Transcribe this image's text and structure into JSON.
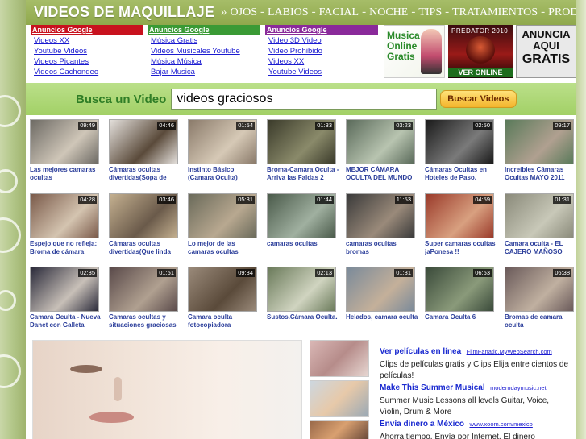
{
  "header": {
    "title": "VIDEOS DE MAQUILLAJE",
    "sep": "»",
    "nav": [
      "OJOS",
      "LABIOS",
      "FACIAL",
      "NOCHE",
      "TIPS",
      "TRATAMIENTOS",
      "PRODUCTOS"
    ]
  },
  "ads": [
    {
      "heading": "Anuncios Google",
      "links": [
        "Videos XX",
        "Youtube Videos",
        "Videos Picantes",
        "Videos Cachondeo"
      ]
    },
    {
      "heading": "Anuncios Google",
      "links": [
        "Música Gratis",
        "Videos Musicales Youtube",
        "Música Música",
        "Bajar Musica"
      ]
    },
    {
      "heading": "Anuncios Google",
      "links": [
        "Video 3D Video",
        "Video Prohibido",
        "Videos XX",
        "Youtube Videos"
      ]
    }
  ],
  "banners": {
    "music": {
      "line1": "Musica",
      "line2": "Online",
      "line3": "Gratis"
    },
    "predator": {
      "top": "PREDATOR 2010",
      "bottom": "VER ONLINE"
    },
    "anuncia": {
      "line1": "ANUNCIA",
      "line2": "AQUI",
      "line3": "GRATIS"
    }
  },
  "search": {
    "label": "Busca un Video",
    "value": "videos graciosos",
    "button": "Buscar Videos"
  },
  "videos": [
    {
      "title": "Las mejores camaras ocultas",
      "duration": "09:49",
      "c1": "#6d6a64",
      "c2": "#cfc6b8"
    },
    {
      "title": "Cámaras ocultas divertidas(Sopa de",
      "duration": "04:46",
      "c1": "#e4e0dc",
      "c2": "#5a4a3a"
    },
    {
      "title": "Instinto Básico (Camara Oculta)",
      "duration": "01:54",
      "c1": "#8a7a6a",
      "c2": "#d6c9b6"
    },
    {
      "title": "Broma-Camara Oculta - Arriva las Faldas 2",
      "duration": "01:33",
      "c1": "#3a3a2a",
      "c2": "#8a8a6a"
    },
    {
      "title": "MEJOR CÁMARA OCULTA DEL MUNDO",
      "duration": "03:23",
      "c1": "#5a6a5a",
      "c2": "#b8c4b0"
    },
    {
      "title": "Cámaras Ocultas en Hoteles de Paso.",
      "duration": "02:50",
      "c1": "#1a1a1a",
      "c2": "#7a7a7a"
    },
    {
      "title": "Increíbles Cámaras Ocultas MAYO 2011",
      "duration": "09:17",
      "c1": "#5a7a5a",
      "c2": "#b0a090"
    },
    {
      "title": "Espejo que no refleja: Broma de cámara",
      "duration": "04:28",
      "c1": "#7a5a4a",
      "c2": "#d4c4b0"
    },
    {
      "title": "Cámaras ocultas divertidas(Que linda",
      "duration": "03:46",
      "c1": "#c4b090",
      "c2": "#6a5a4a"
    },
    {
      "title": "Lo mejor de las camaras ocultas",
      "duration": "05:31",
      "c1": "#6a6a5a",
      "c2": "#b8a890"
    },
    {
      "title": "camaras ocultas",
      "duration": "01:44",
      "c1": "#4a5a4a",
      "c2": "#a0b0a0"
    },
    {
      "title": "camaras ocultas bromas",
      "duration": "11:53",
      "c1": "#3a3a3a",
      "c2": "#9a8a7a"
    },
    {
      "title": "Super camaras ocultas jaPonesa !!",
      "duration": "04:59",
      "c1": "#9a3a2a",
      "c2": "#d8a080"
    },
    {
      "title": "Camara oculta - EL CAJERO MAÑOSO",
      "duration": "01:31",
      "c1": "#8a8a7a",
      "c2": "#c8c8b8"
    },
    {
      "title": "Camara Oculta - Nueva Danet con Galleta",
      "duration": "02:35",
      "c1": "#2a2a3a",
      "c2": "#c8c0b8"
    },
    {
      "title": "Camaras ocultas y situaciones graciosas",
      "duration": "01:51",
      "c1": "#5a4a4a",
      "c2": "#b0a090"
    },
    {
      "title": "Camara oculta fotocopiadora",
      "duration": "09:34",
      "c1": "#9a8a7a",
      "c2": "#5a4a3a"
    },
    {
      "title": "Sustos.Cámara Oculta.",
      "duration": "02:13",
      "c1": "#6a7a5a",
      "c2": "#d0d4c0"
    },
    {
      "title": "Helados, camara oculta",
      "duration": "01:31",
      "c1": "#7a8a9a",
      "c2": "#c4b09a"
    },
    {
      "title": "Camara Oculta 6",
      "duration": "06:53",
      "c1": "#3a4a3a",
      "c2": "#8a9a7a"
    },
    {
      "title": "Bromas de camara oculta",
      "duration": "06:38",
      "c1": "#6a5a5a",
      "c2": "#c0b0a0"
    }
  ],
  "side_ads": [
    {
      "title": "Ver películas en línea",
      "url": "FilmFanatic.MyWebSearch.com",
      "desc": "Clips de películas gratis y Clips Elija entre cientos de películas!"
    },
    {
      "title": "Make This Summer Musical",
      "url": "moderndaymusic.net",
      "desc": "Summer Music Lessons all levels Guitar, Voice, Violin, Drum & More"
    },
    {
      "title": "Envía dinero a México",
      "url": "www.xoom.com/mexico",
      "desc": "Ahorra tiempo. Envía por Internet. El dinero disponible"
    }
  ]
}
